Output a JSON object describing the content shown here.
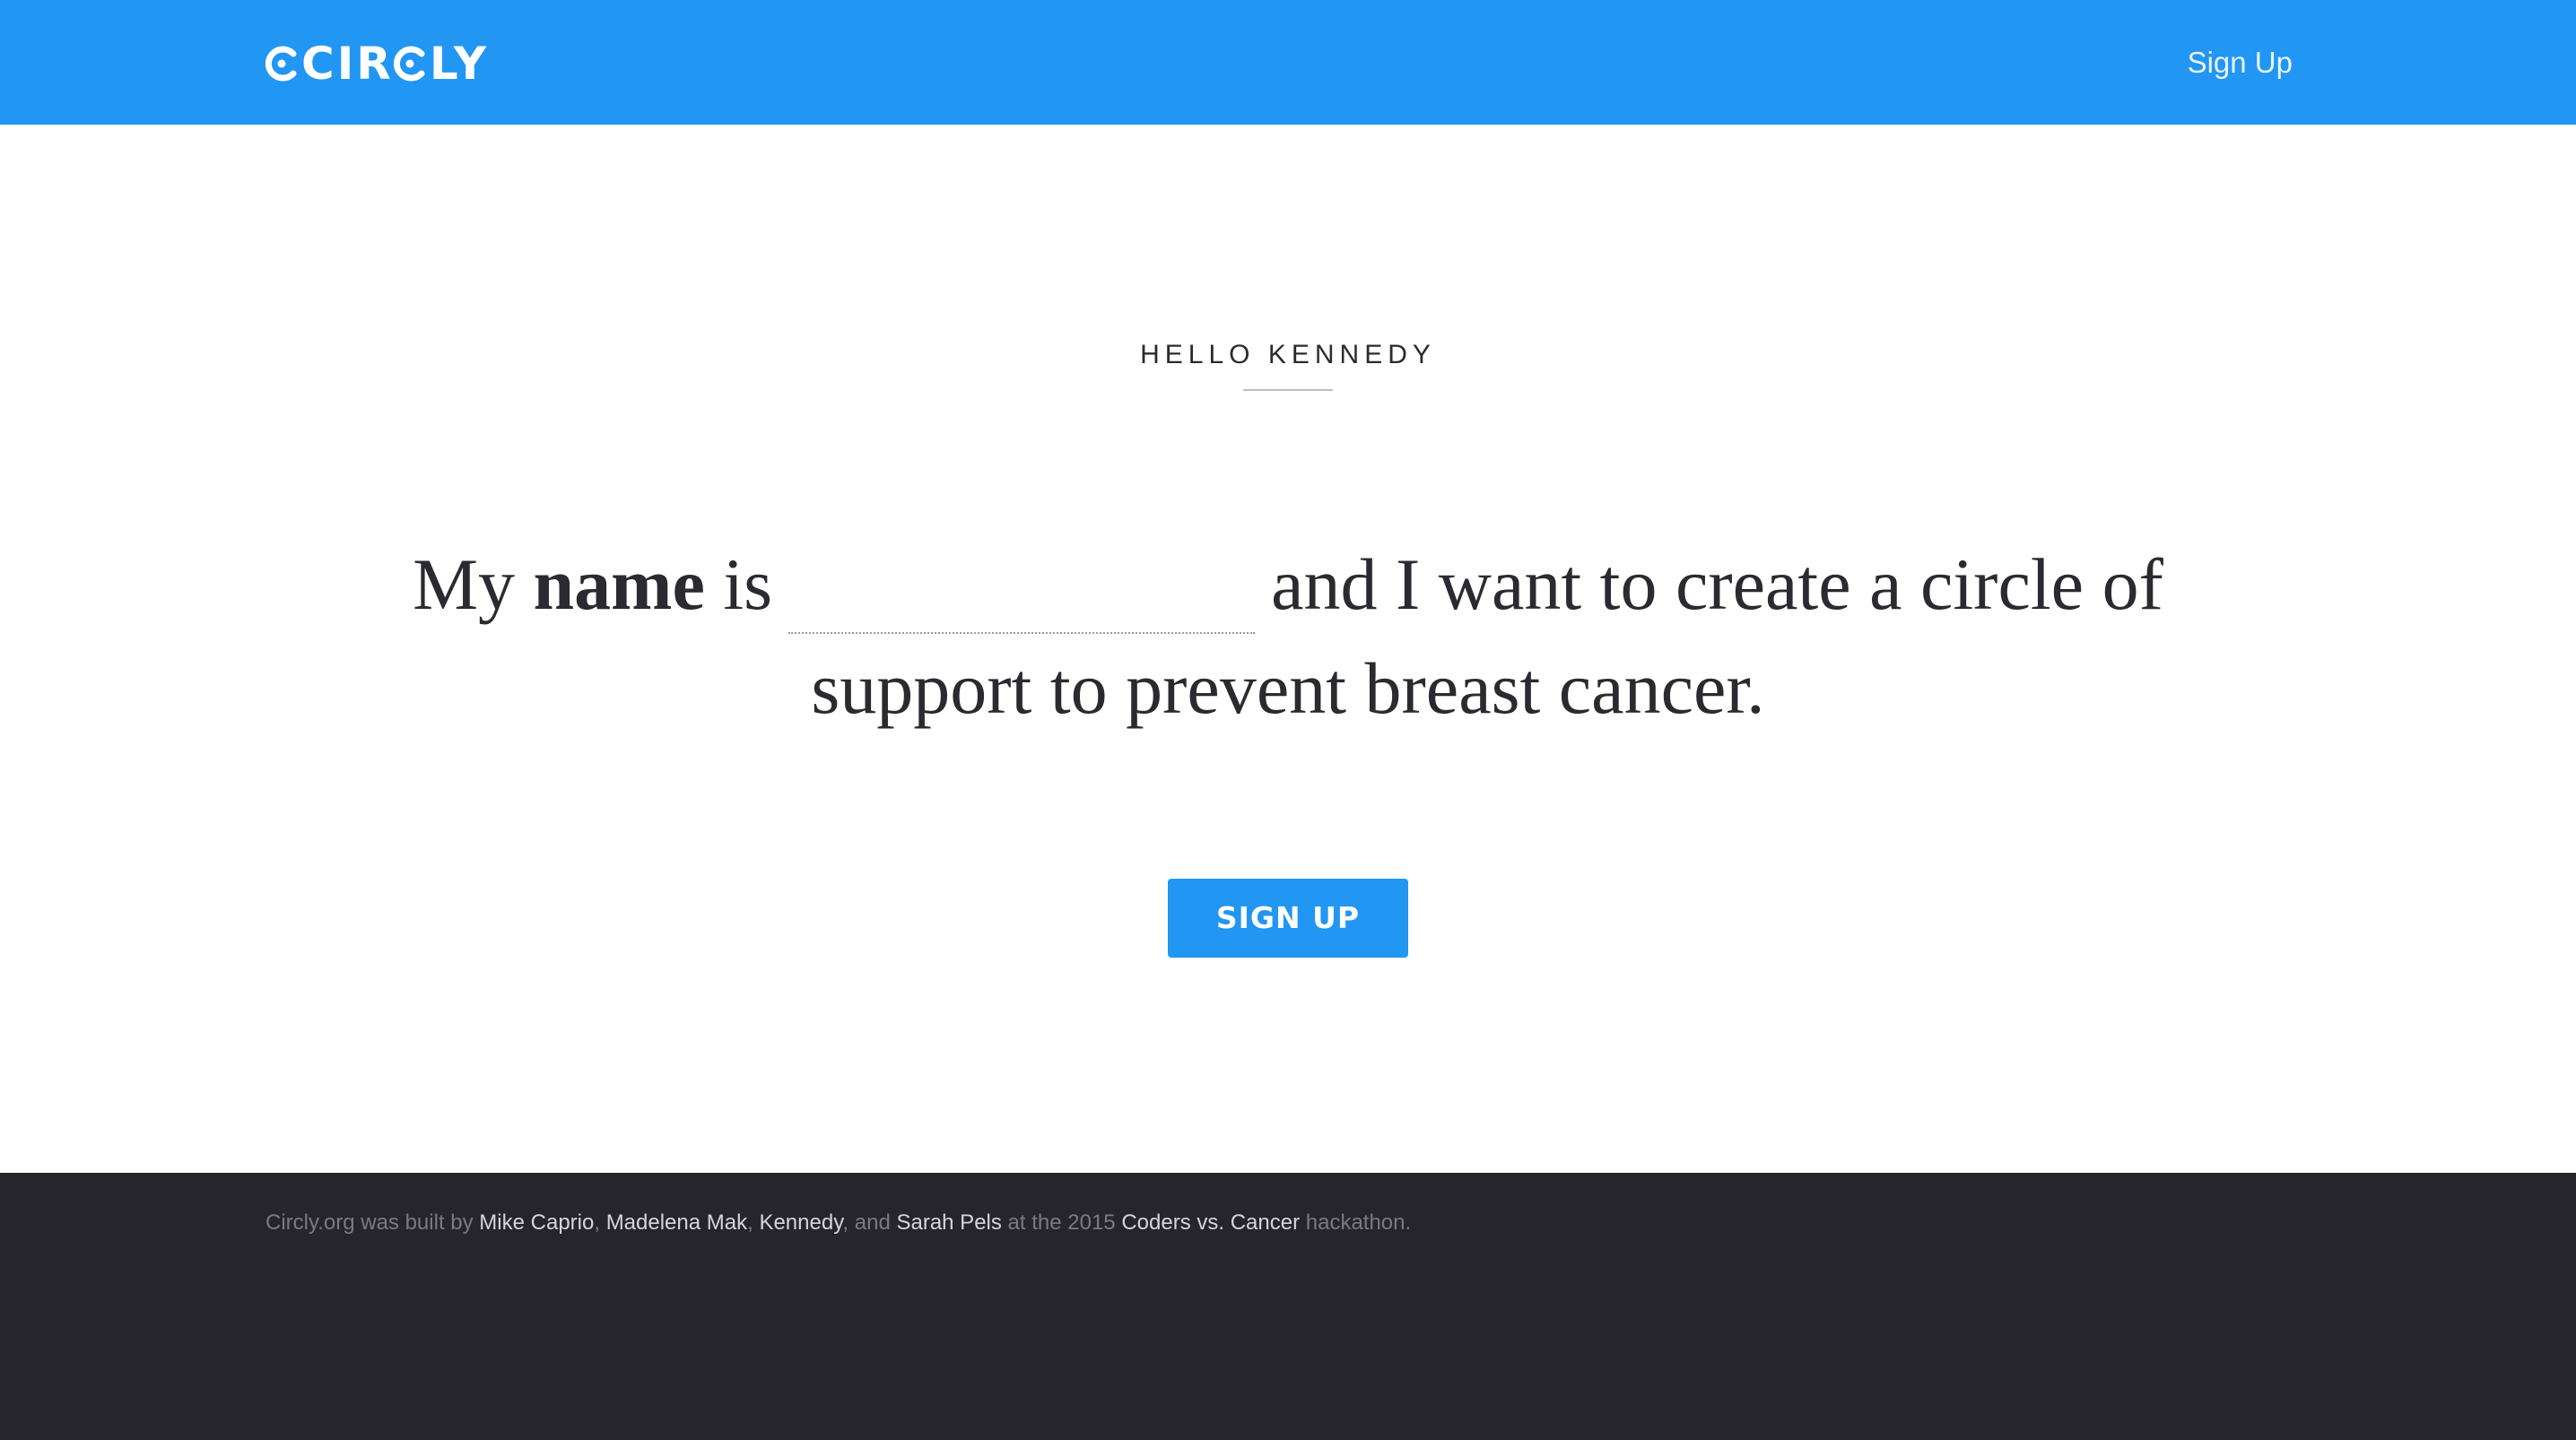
{
  "header": {
    "logo_text_pre": "CIR",
    "logo_text_post": "LY",
    "logo_alt": "CIRCLY",
    "nav_signup_label": "Sign Up",
    "background_color": "#2196f3"
  },
  "main": {
    "greeting": "HELLO KENNEDY",
    "statement": {
      "lead_1": "My ",
      "emphasis": "name",
      "lead_2": " is",
      "name_input_value": "",
      "name_input_placeholder": "",
      "tail": "and I want to create a circle of support to prevent breast cancer."
    },
    "cta_label": "SIGN UP",
    "accent_color": "#2196f3"
  },
  "footer": {
    "prefix": "Circly.org was built by ",
    "credits": [
      {
        "name": "Mike Caprio"
      },
      {
        "name": "Madelena Mak"
      },
      {
        "name": "Kennedy"
      },
      {
        "name": "Sarah Pels"
      }
    ],
    "sep_1": ", ",
    "sep_2": ", ",
    "sep_3": ", and ",
    "middle": " at the 2015 ",
    "event": "Coders vs. Cancer",
    "suffix": " hackathon.",
    "background_color": "#26252b"
  }
}
